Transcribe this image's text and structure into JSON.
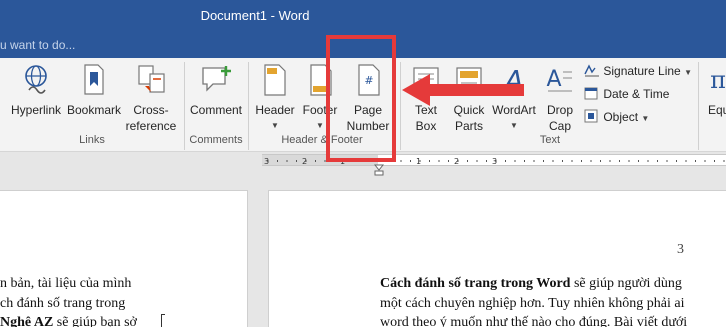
{
  "window": {
    "title": "Document1 - Word",
    "tell_me": "u want to do..."
  },
  "ribbon": {
    "links": {
      "hyperlink": "Hyperlink",
      "bookmark": "Bookmark",
      "cross1": "Cross-",
      "cross2": "reference",
      "group": "Links"
    },
    "comments": {
      "comment": "Comment",
      "group": "Comments"
    },
    "header_footer": {
      "header": "Header",
      "footer": "Footer",
      "page1": "Page",
      "page2": "Number",
      "group": "Header & Footer"
    },
    "text": {
      "textbox1": "Text",
      "textbox2": "Box",
      "quickparts1": "Quick",
      "quickparts2": "Parts",
      "wordart": "WordArt",
      "dropcap1": "Drop",
      "dropcap2": "Cap",
      "signature_line": "Signature Line",
      "date_time": "Date & Time",
      "object": "Object",
      "group": "Text"
    },
    "equation_partial": "Equ"
  },
  "ruler_numbers": [
    "3",
    "2",
    "1",
    "1",
    "2",
    "3"
  ],
  "document": {
    "page_number": "3",
    "left_lines": [
      "n bản, tài liệu của mình",
      "ch đánh số trang trong",
      "Nghệ AZ"
    ],
    "left_line3_rest": " sẽ giúp bạn sở",
    "right_bold": "Cách đánh số trang trong Word",
    "right_line1_rest": " sẽ giúp người dùng",
    "right_line2": "một cách chuyên nghiệp hơn. Tuy nhiên không phải ai",
    "right_line3": "word theo ý muốn như thế nào cho đúng. Bài viết dưới"
  },
  "colors": {
    "title_bar": "#2b579a",
    "highlight": "#e53a3a",
    "icon_blue": "#2b579a"
  }
}
